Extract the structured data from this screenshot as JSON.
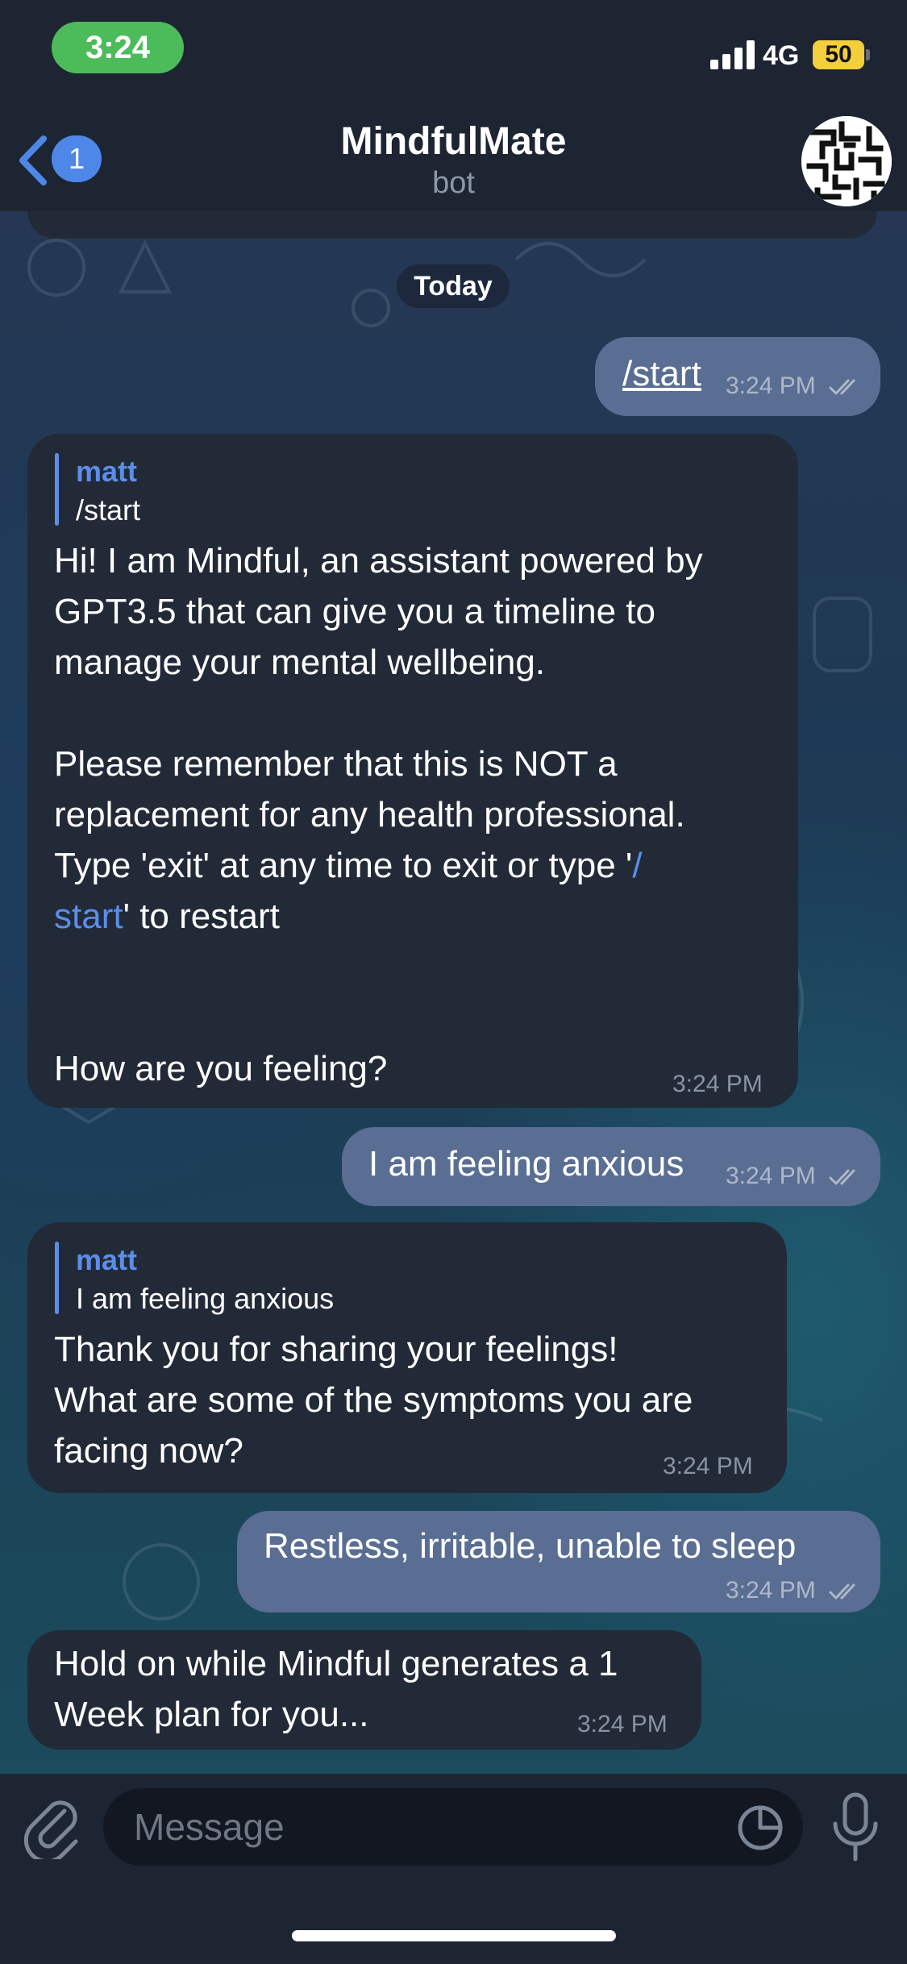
{
  "status_bar": {
    "time": "3:24",
    "network": "4G",
    "battery": "50"
  },
  "header": {
    "back_badge": "1",
    "title": "MindfulMate",
    "subtitle": "bot"
  },
  "chat": {
    "date_label": "Today",
    "messages": [
      {
        "direction": "out",
        "text": "/start",
        "time": "3:24 PM"
      },
      {
        "direction": "in",
        "reply_name": "matt",
        "reply_text": "/start",
        "p1": "Hi! I am Mindful, an assistant powered by\nGPT3.5 that can give you a timeline to\nmanage your mental wellbeing.",
        "p2": "Please remember that this is NOT a\nreplacement for any health professional.",
        "p3_a": "Type 'exit' at any time to exit or type '",
        "p3_link1": "/",
        "p3_link2": "start",
        "p3_b": "' to restart",
        "p4": "How are you feeling?",
        "time": "3:24 PM"
      },
      {
        "direction": "out",
        "text": "I am feeling anxious",
        "time": "3:24 PM"
      },
      {
        "direction": "in",
        "reply_name": "matt",
        "reply_text": "I am feeling anxious",
        "text": "Thank you for sharing your feelings!\nWhat are some of the symptoms you are\nfacing now?",
        "time": "3:24 PM"
      },
      {
        "direction": "out",
        "text": "Restless, irritable, unable to sleep",
        "time": "3:24 PM"
      },
      {
        "direction": "in",
        "text": "Hold on while Mindful generates a 1\nWeek plan for you...",
        "time": "3:24 PM"
      }
    ]
  },
  "input": {
    "placeholder": "Message"
  },
  "colors": {
    "incoming_bubble": "#222a38",
    "outgoing_bubble": "#5a6e93",
    "accent": "#5b8ee9",
    "time_pill": "#4cbb5a",
    "battery": "#f3cf3c"
  },
  "icons": [
    "back-chevron-icon",
    "attach-paperclip-icon",
    "sticker-icon",
    "microphone-icon",
    "double-check-icon",
    "signal-bars-icon",
    "battery-icon"
  ]
}
